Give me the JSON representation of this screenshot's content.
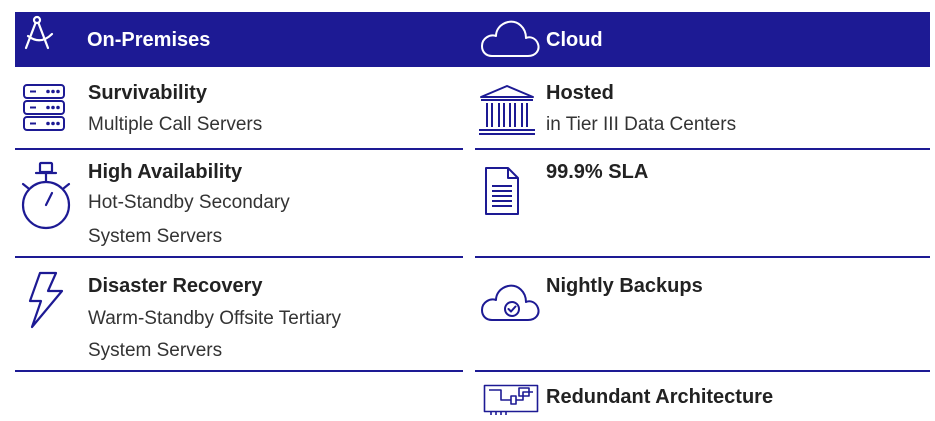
{
  "header": {
    "left_label": "On-Premises",
    "right_label": "Cloud",
    "color": "#1d1a94"
  },
  "on_premises": [
    {
      "icon": "server-icon",
      "title": "Survivability",
      "lines": [
        "Multiple Call Servers"
      ]
    },
    {
      "icon": "stopwatch-icon",
      "title": "High Availability",
      "lines": [
        "Hot-Standby Secondary",
        "System Servers"
      ]
    },
    {
      "icon": "lightning-icon",
      "title": "Disaster Recovery",
      "lines": [
        "Warm-Standby Offsite Tertiary",
        "System Servers"
      ]
    }
  ],
  "cloud": [
    {
      "icon": "building-icon",
      "title": "Hosted",
      "lines": [
        "in Tier III Data Centers"
      ]
    },
    {
      "icon": "document-icon",
      "title": "99.9% SLA",
      "lines": []
    },
    {
      "icon": "cloud-check-icon",
      "title": "Nightly Backups",
      "lines": []
    },
    {
      "icon": "circuit-icon",
      "title": "Redundant Architecture",
      "lines": []
    }
  ]
}
